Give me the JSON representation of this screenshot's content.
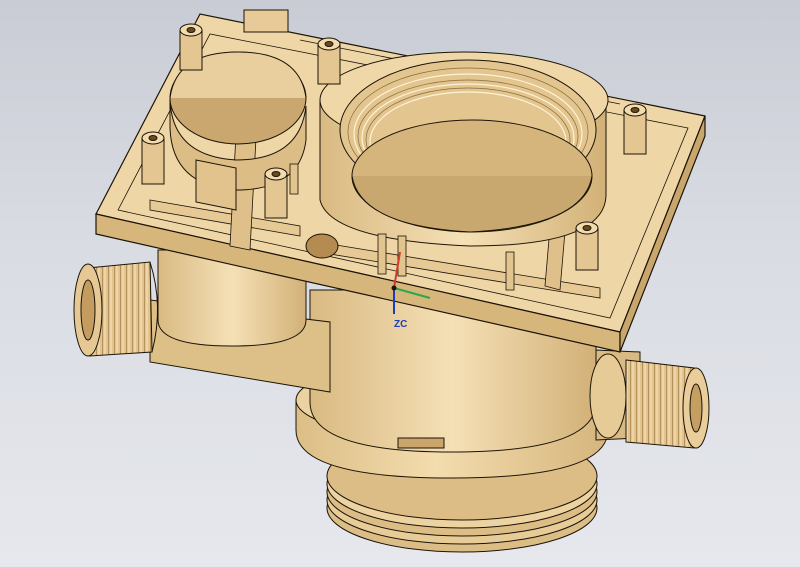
{
  "viewport": {
    "background_top": "#c9ccd4",
    "background_bottom": "#e6e8ed"
  },
  "model": {
    "body_color": "#f1d9a8",
    "shade_color": "#dcbe86",
    "dark_shade": "#c7a56d",
    "edge_color": "#1c1408",
    "threads_color": "#d9b27a"
  },
  "triad": {
    "x_color": "#d23a2a",
    "y_color": "#2aa84a",
    "z_color": "#1a3cc0",
    "z_label": "ZC"
  }
}
